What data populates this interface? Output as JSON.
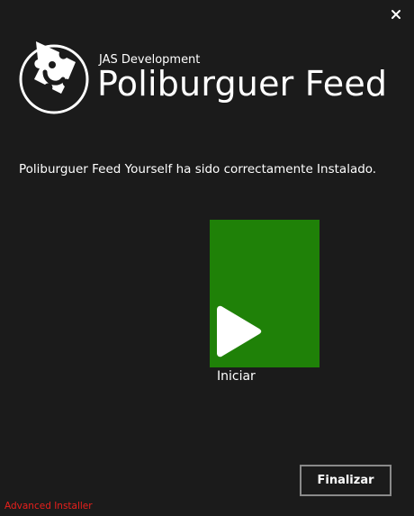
{
  "window": {
    "close_icon": "close-icon"
  },
  "header": {
    "logo_icon": "puzzle-logo-icon",
    "vendor": "JAS Development",
    "product": "Poliburguer Feed"
  },
  "main": {
    "message": "Poliburguer Feed Yourself ha sido correctamente Instalado.",
    "launch": {
      "label": "Iniciar",
      "icon": "play-icon",
      "tile_color": "#1f8108"
    }
  },
  "footer": {
    "finish_label": "Finalizar",
    "brand": "Advanced Installer",
    "brand_color": "#e8201c"
  },
  "colors": {
    "background": "#1b1b1b",
    "text": "#ffffff"
  }
}
